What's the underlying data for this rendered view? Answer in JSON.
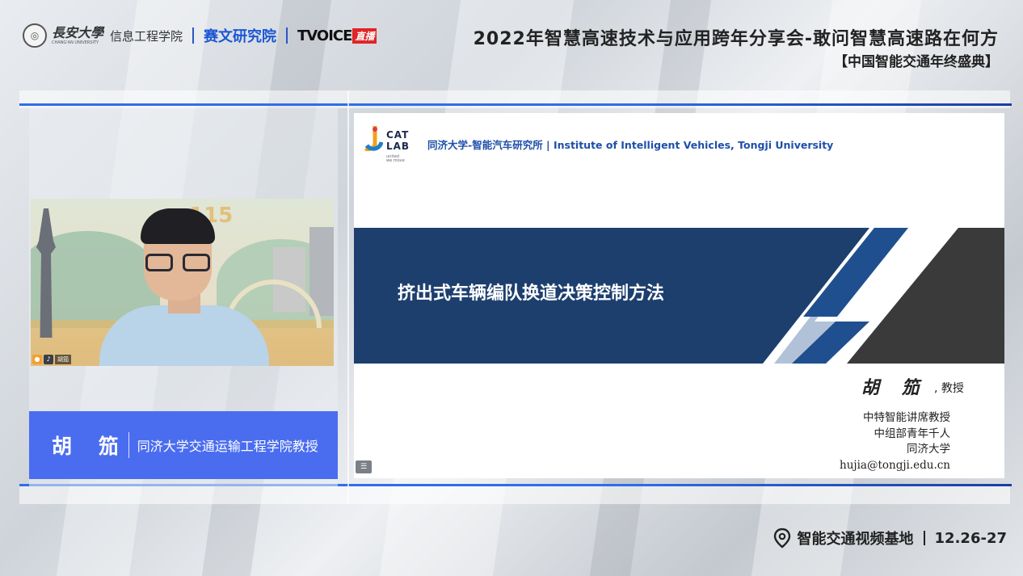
{
  "header": {
    "university_name": "長安大學",
    "university_en": "CHANG'AN UNIVERSITY",
    "school": "信息工程学院",
    "partner": "赛文研究院",
    "tvoice": "TVOICE",
    "tvoice_badge": "直播",
    "event_title": "2022年智慧高速技术与应用跨年分享会-敢问智慧高速路在何方",
    "event_subtitle": "【中国智能交通年终盛典】"
  },
  "speaker": {
    "name": "胡 笳",
    "title": "同济大学交通运输工程学院教授",
    "video_badge_name": "胡笳",
    "video_bg_number": "115"
  },
  "slide": {
    "logo_text_line1": "CAT",
    "logo_text_line2": "LAB",
    "logo_tagline_1": "united",
    "logo_tagline_2": "we move",
    "header": "同济大学-智能汽车研究所 | Institute of Intelligent Vehicles, Tongji University",
    "title": "挤出式车辆编队换道决策控制方法",
    "signature": "胡 笳",
    "signature_suffix": ", 教授",
    "credentials": [
      "中特智能讲席教授",
      "中组部青年千人",
      "同济大学",
      "hujia@tongji.edu.cn"
    ],
    "colors": {
      "banner_navy": "#1d3f6e",
      "banner_dark": "#3a3a3a",
      "stripe_blue": "#1f4f8f"
    }
  },
  "footer": {
    "label": "智能交通视频基地",
    "dates": "12.26-27"
  },
  "icons": [
    "university-seal-icon",
    "location-pin-icon",
    "menu-icon",
    "person-icon",
    "mic-icon"
  ]
}
